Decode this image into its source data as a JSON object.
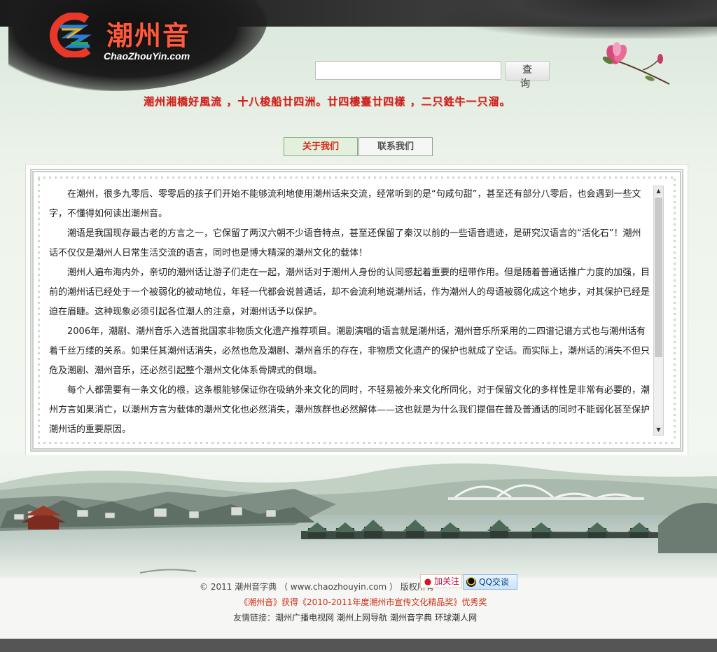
{
  "header": {
    "logo_cn": "潮州音",
    "logo_en": "ChaoZhouYin.com",
    "slogan": "潮州湘橋好風流 ，十八梭船廿四洲。廿四樓臺廿四樣 ，二只鉎牛一只溜。"
  },
  "search": {
    "placeholder": "",
    "value": "",
    "button_label": "查 询"
  },
  "tabs": [
    {
      "label": "关于我们",
      "active": true
    },
    {
      "label": "联系我们",
      "active": false
    }
  ],
  "article": {
    "paragraphs": [
      "在潮州，很多九零后、零零后的孩子们开始不能够流利地使用潮州话来交流，经常听到的是“句咸句甜”，甚至还有部分八零后，也会遇到一些文字，不懂得如何读出潮州音。",
      "潮语是我国现存最古老的方言之一，它保留了两汉六朝不少语音特点，甚至还保留了秦汉以前的一些语音遗迹，是研究汉语言的“活化石”！潮州话不仅仅是潮州人日常生活交流的语言，同时也是博大精深的潮州文化的载体！",
      "潮州人遍布海内外，亲切的潮州话让游子们走在一起，潮州话对于潮州人身份的认同感起着重要的纽带作用。但是随着普通话推广力度的加强，目前的潮州话已经处于一个被弱化的被动地位，年轻一代都会说普通话，却不会流利地说潮州话，作为潮州人的母语被弱化成这个地步，对其保护已经是迫在眉睫。这种现象必须引起各位潮人的注意，对潮州话予以保护。",
      "2006年，潮剧、潮州音乐入选首批国家非物质文化遗产推荐项目。潮剧演唱的语言就是潮州话，潮州音乐所采用的二四谱记谱方式也与潮州话有着千丝万缕的关系。如果任其潮州话消失，必然也危及潮剧、潮州音乐的存在，非物质文化遗产的保护也就成了空话。而实际上，潮州话的消失不但只危及潮剧、潮州音乐，还必然引起整个潮州文化体系骨牌式的倒塌。",
      "每个人都需要有一条文化的根，这条根能够保证你在吸纳外来文化的同时，不轻易被外来文化所同化，对于保留文化的多样性是非常有必要的，潮州方言如果消亡，以潮州方言为载体的潮州文化也必然消失，潮州族群也必然解体——这也就是为什么我们提倡在普及普通话的同时不能弱化甚至保护潮州话的重要原因。"
    ]
  },
  "footer": {
    "copyright": "© 2011 潮州音字典 （ www.chaozhouyin.com ） 版权所有",
    "weibo_label": "加关注",
    "qq_label": "QQ交谈",
    "award": "《潮州音》获得《2010-2011年度潮州市宣传文化精品奖》优秀奖",
    "links_prefix": "友情链接：",
    "links": [
      "潮州广播电视网",
      "潮州上网导航",
      "潮州音字典",
      "环球潮人网"
    ]
  }
}
